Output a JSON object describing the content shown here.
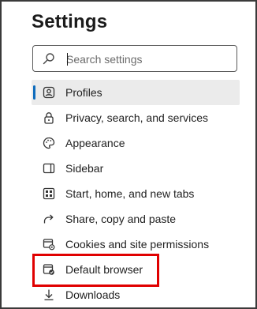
{
  "header": {
    "title": "Settings"
  },
  "search": {
    "placeholder": "Search settings",
    "value": ""
  },
  "menu": {
    "items": [
      {
        "label": "Profiles",
        "icon": "profile-icon",
        "active": true
      },
      {
        "label": "Privacy, search, and services",
        "icon": "lock-icon"
      },
      {
        "label": "Appearance",
        "icon": "palette-icon"
      },
      {
        "label": "Sidebar",
        "icon": "sidebar-icon"
      },
      {
        "label": "Start, home, and new tabs",
        "icon": "home-tabs-icon"
      },
      {
        "label": "Share, copy and paste",
        "icon": "share-icon"
      },
      {
        "label": "Cookies and site permissions",
        "icon": "cookies-permissions-icon"
      },
      {
        "label": "Default browser",
        "icon": "default-browser-icon",
        "highlighted": true
      },
      {
        "label": "Downloads",
        "icon": "download-icon"
      }
    ]
  },
  "colors": {
    "accent": "#0f6cbd",
    "highlight_border": "#e00000",
    "active_bg": "#ebebeb"
  }
}
